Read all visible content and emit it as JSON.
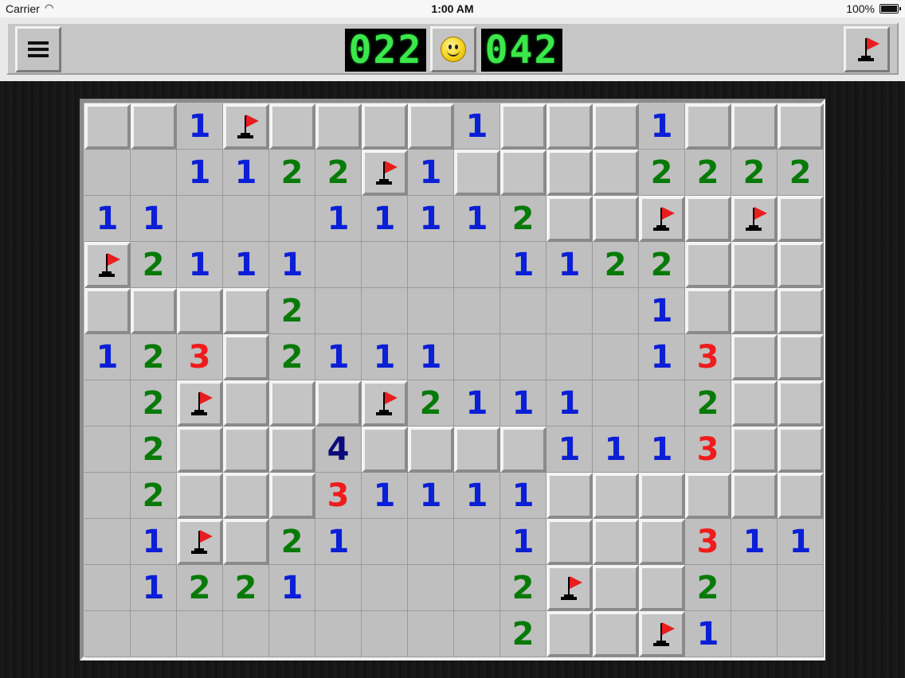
{
  "status_bar": {
    "carrier": "Carrier",
    "time": "1:00 AM",
    "battery": "100%"
  },
  "toolbar": {
    "mine_counter": "022",
    "timer": "042",
    "menu_icon": "hamburger-icon",
    "face_icon": "smiley-face-icon",
    "flag_mode_icon": "flag-icon"
  },
  "colors": {
    "1": "#0b1fd6",
    "2": "#067a06",
    "3": "#f01b1b",
    "4": "#0a0a7a",
    "lcd": "#3be84a",
    "flag": "#e81e1e"
  },
  "board": {
    "columns": 16,
    "rows": 12,
    "legend": "C = unopened cell, F = flagged cell, . = opened empty cell, digit = opened cell with adjacent mine count",
    "grid": [
      [
        "C",
        "C",
        "1",
        "F",
        "C",
        "C",
        "C",
        "C",
        "1",
        "C",
        "C",
        "C",
        "1",
        "C",
        "C",
        "C"
      ],
      [
        ".",
        ".",
        "1",
        "1",
        "2",
        "2",
        "F",
        "1",
        "C",
        "C",
        "C",
        "C",
        "2",
        "2",
        "2",
        "2"
      ],
      [
        "1",
        "1",
        ".",
        ".",
        ".",
        "1",
        "1",
        "1",
        "1",
        "2",
        "C",
        "C",
        "F",
        "C",
        "F",
        "C"
      ],
      [
        "F",
        "2",
        "1",
        "1",
        "1",
        ".",
        ".",
        ".",
        ".",
        "1",
        "1",
        "2",
        "2",
        "C",
        "C",
        "C"
      ],
      [
        "C",
        "C",
        "C",
        "C",
        "2",
        ".",
        ".",
        ".",
        ".",
        ".",
        ".",
        ".",
        "1",
        "C",
        "C",
        "C"
      ],
      [
        "1",
        "2",
        "3",
        "C",
        "2",
        "1",
        "1",
        "1",
        ".",
        ".",
        ".",
        ".",
        "1",
        "3",
        "C",
        "C"
      ],
      [
        ".",
        "2",
        "F",
        "C",
        "C",
        "C",
        "F",
        "2",
        "1",
        "1",
        "1",
        ".",
        ".",
        "2",
        "C",
        "C"
      ],
      [
        ".",
        "2",
        "C",
        "C",
        "C",
        "4",
        "C",
        "C",
        "C",
        "C",
        "1",
        "1",
        "1",
        "3",
        "C",
        "C"
      ],
      [
        ".",
        "2",
        "C",
        "C",
        "C",
        "3",
        "1",
        "1",
        "1",
        "1",
        "C",
        "C",
        "C",
        "C",
        "C",
        "C"
      ],
      [
        ".",
        "1",
        "F",
        "C",
        "2",
        "1",
        ".",
        ".",
        ".",
        "1",
        "C",
        "C",
        "C",
        "3",
        "1",
        "1"
      ],
      [
        ".",
        "1",
        "2",
        "2",
        "1",
        ".",
        ".",
        ".",
        ".",
        "2",
        "F",
        "C",
        "C",
        "2",
        ".",
        "."
      ],
      [
        ".",
        ".",
        ".",
        ".",
        ".",
        ".",
        ".",
        ".",
        ".",
        "2",
        "C",
        "C",
        "F",
        "1",
        ".",
        "."
      ]
    ]
  }
}
